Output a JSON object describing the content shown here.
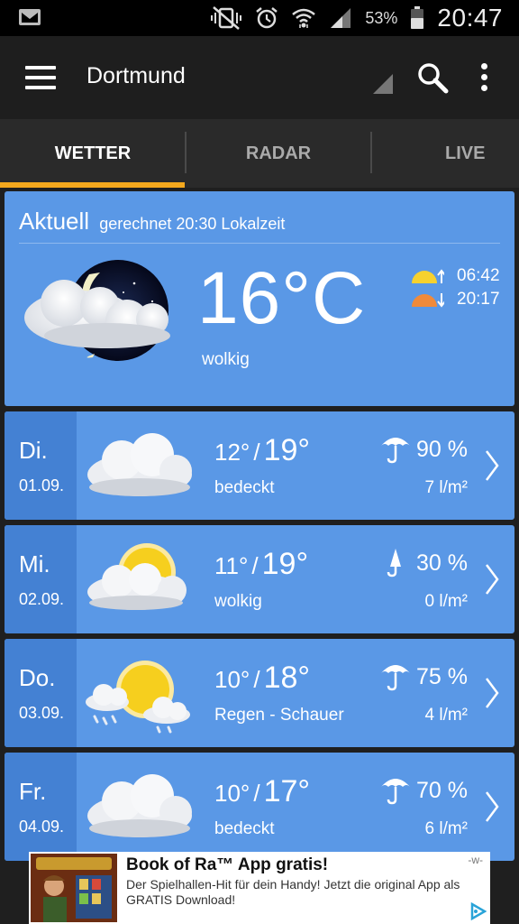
{
  "statusbar": {
    "battery": "53%",
    "time": "20:47",
    "icons": [
      "mail-icon",
      "mute-vibrate-icon",
      "alarm-icon",
      "wifi-icon",
      "signal-icon",
      "battery-icon"
    ]
  },
  "appbar": {
    "location": "Dortmund",
    "icons": [
      "menu-icon",
      "search-icon",
      "more-vert-icon"
    ]
  },
  "tabs": [
    {
      "label": "WETTER",
      "active": true
    },
    {
      "label": "RADAR",
      "active": false
    },
    {
      "label": "LIVE",
      "active": false
    }
  ],
  "current": {
    "label": "Aktuell",
    "subtitle": "gerechnet 20:30 Lokalzeit",
    "temperature": "16°C",
    "condition": "wolkig",
    "sunrise": "06:42",
    "sunset": "20:17",
    "icon": "moon-cloud-icon"
  },
  "forecast": [
    {
      "day": "Di.",
      "date": "01.09.",
      "min": "12°",
      "max": "19°",
      "condition": "bedeckt",
      "precip_pct": "90 %",
      "precip_amt": "7 l/m²",
      "icon": "overcast-icon",
      "precip_icon": "umbrella-icon"
    },
    {
      "day": "Mi.",
      "date": "02.09.",
      "min": "11°",
      "max": "19°",
      "condition": "wolkig",
      "precip_pct": "30 %",
      "precip_amt": "0 l/m²",
      "icon": "sun-cloud-icon",
      "precip_icon": "umbrella-closed-icon"
    },
    {
      "day": "Do.",
      "date": "03.09.",
      "min": "10°",
      "max": "18°",
      "condition": "Regen - Schauer",
      "precip_pct": "75 %",
      "precip_amt": "4 l/m²",
      "icon": "sun-rain-shower-icon",
      "precip_icon": "umbrella-icon"
    },
    {
      "day": "Fr.",
      "date": "04.09.",
      "min": "10°",
      "max": "17°",
      "condition": "bedeckt",
      "precip_pct": "70 %",
      "precip_amt": "6 l/m²",
      "icon": "overcast-icon",
      "precip_icon": "umbrella-icon"
    }
  ],
  "ad": {
    "title": "Book of Ra™ App gratis!",
    "text": "Der Spielhallen-Hit für dein Handy! Jetzt die original App als GRATIS Download!",
    "marker": "-w-"
  },
  "colors": {
    "card": "#5a98e6",
    "card_side": "#4481d3",
    "accent": "#f4a81d"
  }
}
